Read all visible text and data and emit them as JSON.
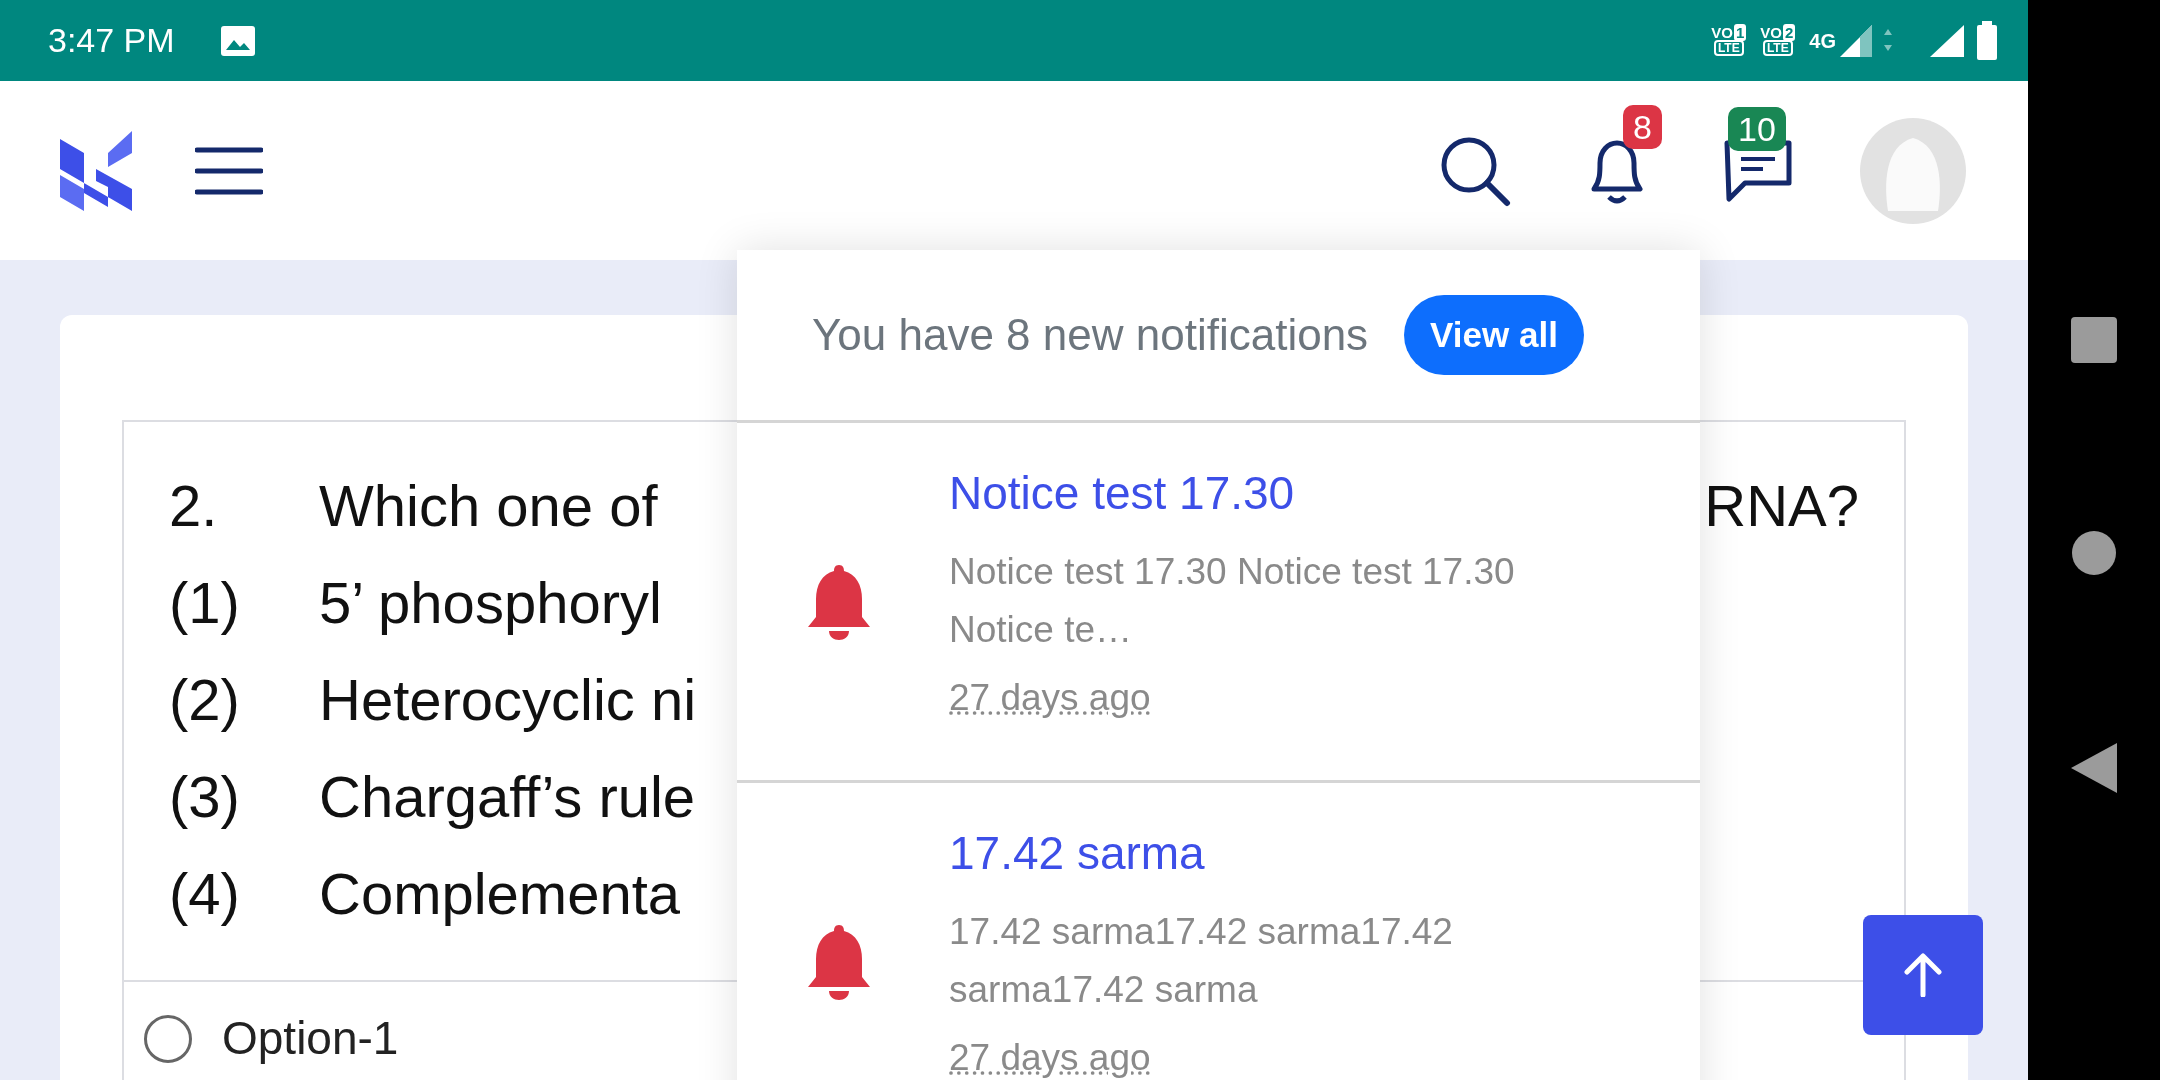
{
  "status_bar": {
    "time": "3:47 PM",
    "sims": [
      {
        "badge": "VO",
        "slot": "1",
        "tech": "LTE"
      },
      {
        "badge": "VO",
        "slot": "2",
        "tech": "LTE"
      }
    ],
    "network": "4G"
  },
  "header": {
    "notifications": {
      "count": "8"
    },
    "messages": {
      "count": "10"
    }
  },
  "question": {
    "lines": [
      {
        "number": "2.",
        "text": "Which one of",
        "tail": "RNA?"
      },
      {
        "number": "(1)",
        "text": "5’ phosphoryl"
      },
      {
        "number": "(2)",
        "text": "Heterocyclic ni"
      },
      {
        "number": "(3)",
        "text": "Chargaff’s rule"
      },
      {
        "number": "(4)",
        "text": "Complementa"
      }
    ],
    "options": [
      {
        "label": "Option-1",
        "selected": false
      }
    ]
  },
  "notifications": {
    "summary": "You have 8 new notifications",
    "button": "View all",
    "items": [
      {
        "title": "Notice test 17.30",
        "body": "Notice test 17.30 Notice test 17.30 Notice te…",
        "time": "27 days ago"
      },
      {
        "title": "17.42 sarma",
        "body": "17.42 sarma17.42 sarma17.42 sarma17.42 sarma",
        "time": "27 days ago"
      }
    ]
  }
}
